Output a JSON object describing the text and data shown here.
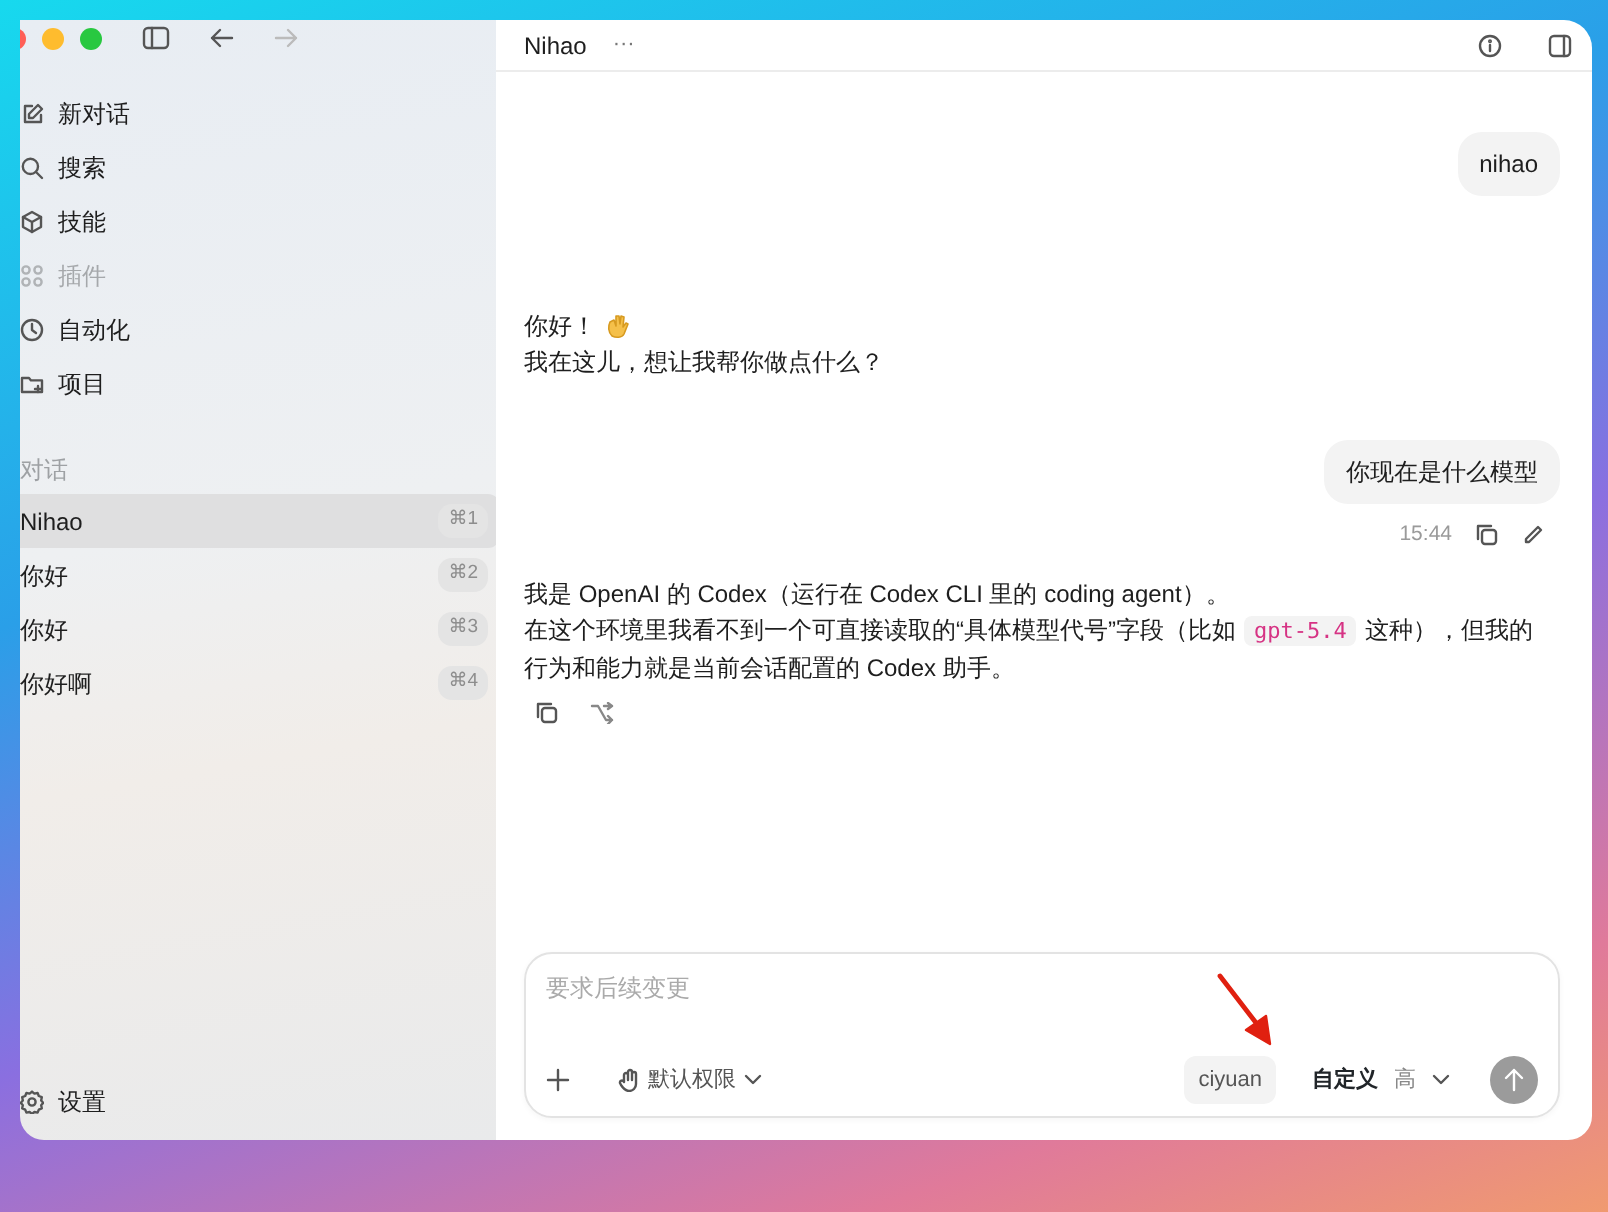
{
  "sidebar": {
    "nav_items": [
      {
        "kind": "compose",
        "label": "新对话",
        "disabled": false
      },
      {
        "kind": "search",
        "label": "搜索",
        "disabled": false
      },
      {
        "kind": "cube",
        "label": "技能",
        "disabled": false
      },
      {
        "kind": "grid",
        "label": "插件",
        "disabled": true
      },
      {
        "kind": "clock",
        "label": "自动化",
        "disabled": false
      },
      {
        "kind": "folder",
        "label": "项目",
        "disabled": false
      }
    ],
    "section_label": "对话",
    "conversations": [
      {
        "title": "Nihao",
        "shortcut": "⌘1",
        "selected": true
      },
      {
        "title": "你好",
        "shortcut": "⌘2",
        "selected": false
      },
      {
        "title": "你好",
        "shortcut": "⌘3",
        "selected": false
      },
      {
        "title": "你好啊",
        "shortcut": "⌘4",
        "selected": false
      }
    ],
    "settings": "设置"
  },
  "header": {
    "title": "Nihao",
    "menu": "···"
  },
  "messages": [
    {
      "kind": "user",
      "text": "nihao"
    },
    {
      "kind": "assistant",
      "wave": true,
      "actions": false,
      "paragraphs": [
        [
          {
            "kind": "text",
            "text": "你好！"
          }
        ],
        [
          {
            "kind": "text",
            "text": "我在这儿，想让我帮你做点什么？"
          }
        ]
      ]
    },
    {
      "kind": "user",
      "text": "你现在是什么模型",
      "time": "15:44"
    },
    {
      "kind": "assistant",
      "wave": false,
      "actions": true,
      "paragraphs": [
        [
          {
            "kind": "text",
            "text": "我是 OpenAI 的 Codex（运行在 Codex CLI 里的 coding agent）。"
          }
        ],
        [
          {
            "kind": "text",
            "text": "在这个环境里我看不到一个可直接读取的“具体模型代号”字段（比如"
          },
          {
            "kind": "code",
            "text": "gpt-5.4"
          },
          {
            "kind": "text",
            "text": "这种），但我的行为和能力就是当前会话配置的 Codex 助手。"
          }
        ]
      ]
    }
  ],
  "composer": {
    "placeholder": "要求后续变更",
    "permission": "默认权限",
    "model": "ciyuan",
    "mode": "自定义",
    "effort": "高"
  }
}
